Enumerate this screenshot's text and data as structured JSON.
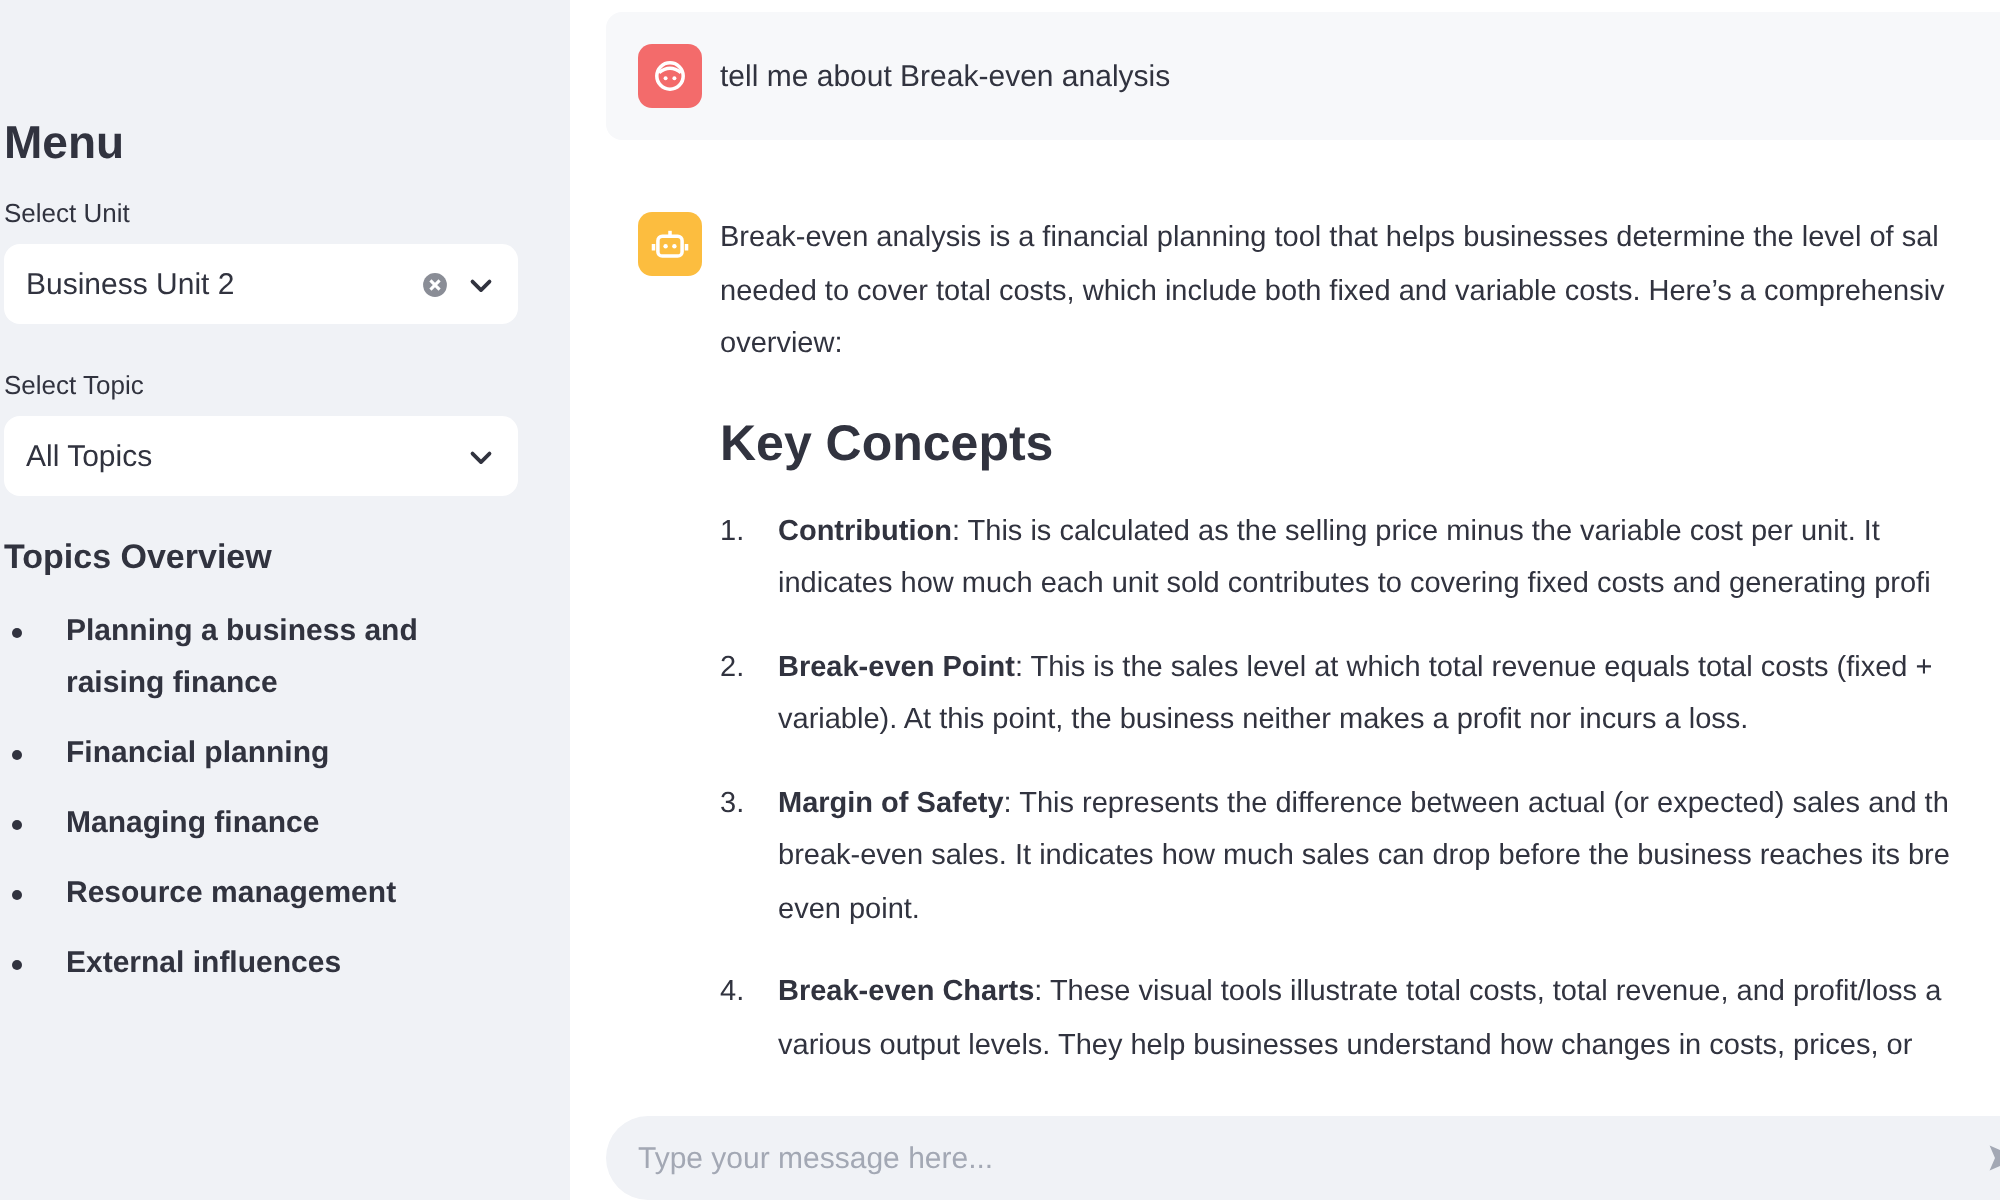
{
  "sidebar": {
    "title": "Menu",
    "selects": [
      {
        "label": "Select Unit",
        "value": "Business Unit 2",
        "clearable": true
      },
      {
        "label": "Select Topic",
        "value": "All Topics",
        "clearable": false
      }
    ],
    "overview_title": "Topics Overview",
    "topics": [
      "Planning a business and raising finance",
      "Financial planning",
      "Managing finance",
      "Resource management",
      "External influences"
    ]
  },
  "chat": {
    "messages": [
      {
        "kind": "user",
        "text": "tell me about Break-even analysis"
      },
      {
        "kind": "assistant",
        "intro": [
          "Break-even analysis is a financial planning tool that helps businesses determine the level of sal",
          "needed to cover total costs, which include both fixed and variable costs. Here’s a comprehensiv",
          "overview:"
        ],
        "heading": "Key Concepts",
        "items": [
          {
            "number": "1.",
            "lines": [
              "**Contribution**: This is calculated as the selling price minus the variable cost per unit. It",
              "indicates how much each unit sold contributes to covering fixed costs and generating profi"
            ]
          },
          {
            "number": "2.",
            "lines": [
              "**Break-even Point**: This is the sales level at which total revenue equals total costs (fixed +",
              "variable). At this point, the business neither makes a profit nor incurs a loss."
            ]
          },
          {
            "number": "3.",
            "lines": [
              "**Margin of Safety**: This represents the difference between actual (or expected) sales and th",
              "break-even sales. It indicates how much sales can drop before the business reaches its bre",
              "even point."
            ]
          },
          {
            "number": "4.",
            "lines": [
              "**Break-even Charts**: These visual tools illustrate total costs, total revenue, and profit/loss a",
              "various output levels. They help businesses understand how changes in costs, prices, or"
            ]
          }
        ]
      }
    ],
    "input": {
      "placeholder": "Type your message here..."
    }
  }
}
